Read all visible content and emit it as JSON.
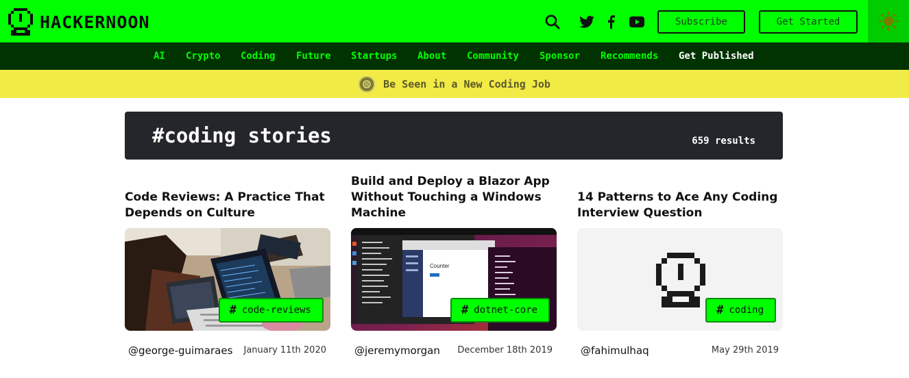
{
  "header": {
    "logo_text": "HACKERNOON",
    "subscribe_label": "Subscribe",
    "get_started_label": "Get Started"
  },
  "nav": {
    "items": [
      "AI",
      "Crypto",
      "Coding",
      "Future",
      "Startups",
      "About",
      "Community",
      "Sponsor",
      "Recommends",
      "Get Published"
    ]
  },
  "banner": {
    "text": "Be Seen in a New Coding Job"
  },
  "search": {
    "title": "#coding stories",
    "count": "659 results"
  },
  "stories": [
    {
      "title": "Code Reviews: A Practice That Depends on Culture",
      "tag": "code-reviews",
      "author": "@george-guimaraes",
      "date": "January 11th 2020"
    },
    {
      "title": "Build and Deploy a Blazor App Without Touching a Windows Machine",
      "tag": "dotnet-core",
      "author": "@jeremymorgan",
      "date": "December 18th 2019",
      "screenshot_text": "Counter"
    },
    {
      "title": "14 Patterns to Ace Any Coding Interview Question",
      "tag": "coding",
      "author": "@fahimulhaq",
      "date": "May 29th 2019"
    }
  ],
  "colors": {
    "brand_green": "#00ff00",
    "nav_bg": "#003300",
    "banner_yellow": "#f2ea45",
    "header_dark": "#24262b"
  },
  "icons": [
    "hackernoon-logo-icon",
    "search-icon",
    "twitter-icon",
    "facebook-icon",
    "youtube-icon",
    "theme-toggle-icon",
    "banner-coin-icon",
    "hackernoon-placeholder-icon"
  ]
}
